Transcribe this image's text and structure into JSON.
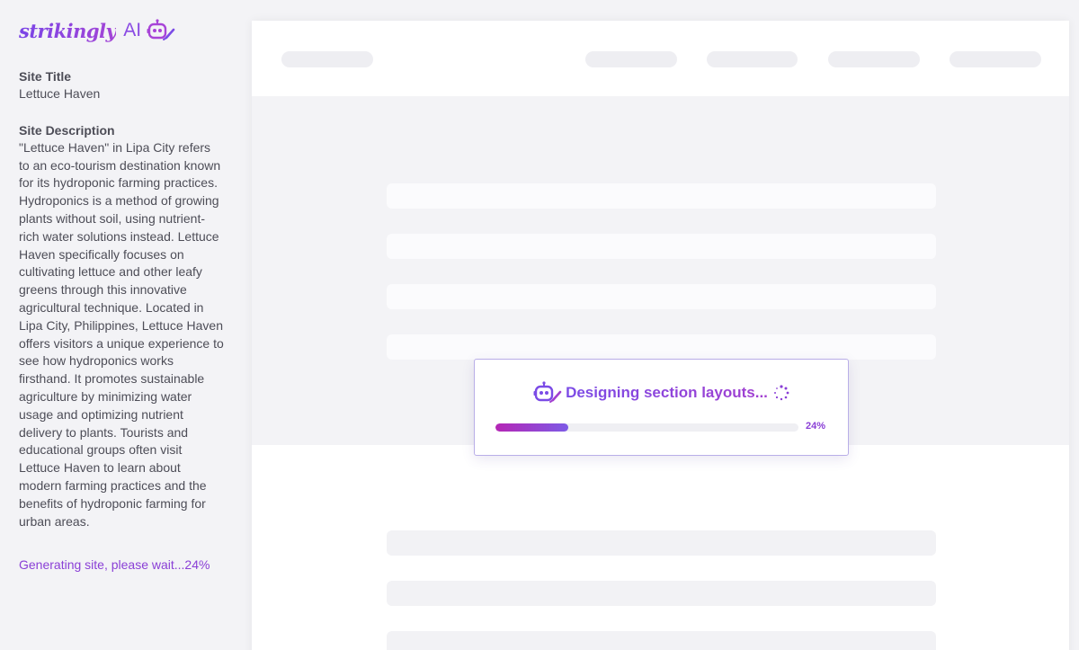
{
  "brand": {
    "wordmark": "strikingly",
    "ai_label": "AI",
    "icon": "robot-pencil-icon",
    "colors": {
      "primary": "#8a3fd6",
      "gradient_start": "#b526b5",
      "gradient_end": "#7d5be6"
    }
  },
  "sidebar": {
    "site_title_label": "Site Title",
    "site_title_value": "Lettuce Haven",
    "site_description_label": "Site Description",
    "site_description_value": "\"Lettuce Haven\" in Lipa City refers to an eco-tourism destination known for its hydroponic farming practices. Hydroponics is a method of growing plants without soil, using nutrient-rich water solutions instead. Lettuce Haven specifically focuses on cultivating lettuce and other leafy greens through this innovative agricultural technique. Located in Lipa City, Philippines, Lettuce Haven offers visitors a unique experience to see how hydroponics works firsthand. It promotes sustainable agriculture by minimizing water usage and optimizing nutrient delivery to plants. Tourists and educational groups often visit Lettuce Haven to learn about modern farming practices and the benefits of hydroponic farming for urban areas.",
    "status_text": "Generating site, please wait...24%"
  },
  "dialog": {
    "icon": "robot-pencil-icon",
    "title": "Designing section layouts...",
    "spinner_icon": "loading-spinner-icon",
    "progress_fraction": 0.24,
    "progress_label": "24%"
  }
}
